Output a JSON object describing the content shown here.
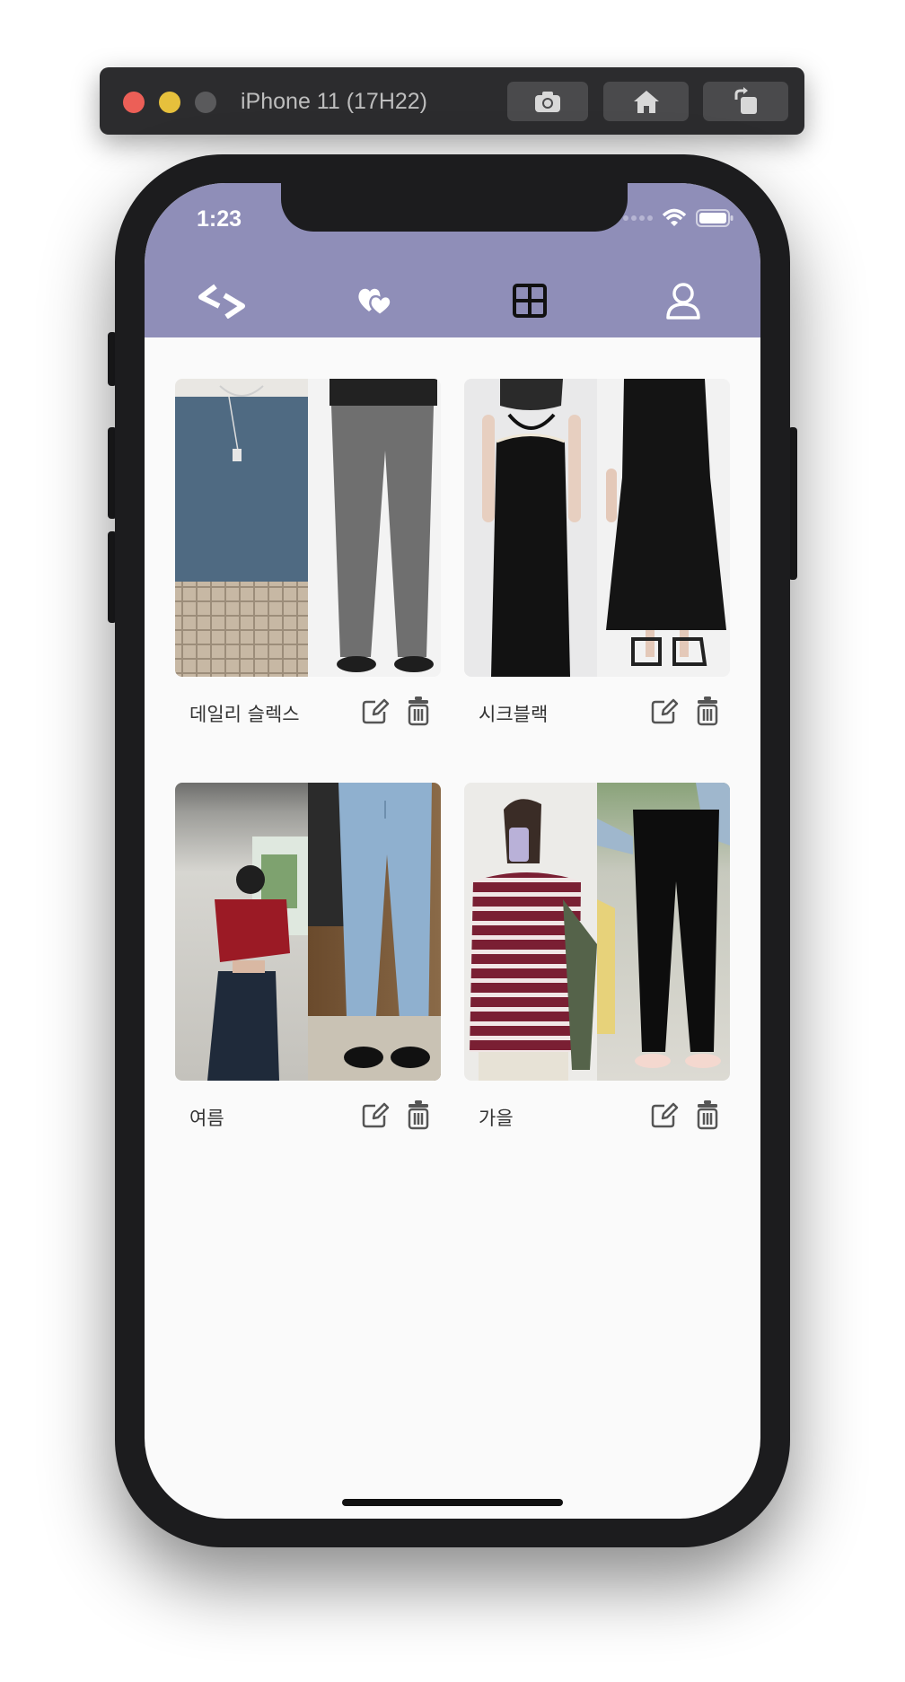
{
  "simulator": {
    "title": "iPhone 11 (17H22)",
    "buttons": [
      "screenshot",
      "home",
      "rotate"
    ]
  },
  "status_bar": {
    "time": "1:23"
  },
  "tabs": [
    {
      "icon": "swap-arrows-icon"
    },
    {
      "icon": "hearts-icon"
    },
    {
      "icon": "grid-icon",
      "active": true
    },
    {
      "icon": "person-icon"
    }
  ],
  "header_color": "#8f8eb8",
  "outfits": [
    {
      "name": "데일리 슬렉스"
    },
    {
      "name": "시크블랙"
    },
    {
      "name": "여름"
    },
    {
      "name": "가을"
    }
  ]
}
